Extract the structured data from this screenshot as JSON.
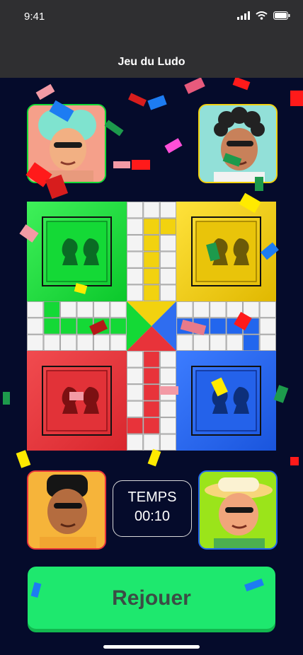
{
  "status_bar": {
    "time": "9:41"
  },
  "header": {
    "title": "Jeu du Ludo"
  },
  "board": {
    "colors": {
      "green": "#14d936",
      "yellow": "#f2d20f",
      "red": "#e8333a",
      "blue": "#2266ee"
    }
  },
  "players": [
    {
      "position": "top-left",
      "color": "#14d936",
      "avatar": "avatar-mint-hair"
    },
    {
      "position": "top-right",
      "color": "#f2d20f",
      "avatar": "avatar-braids"
    },
    {
      "position": "bottom-left",
      "color": "#e8333a",
      "avatar": "avatar-black-hair"
    },
    {
      "position": "bottom-right",
      "color": "#2266ee",
      "avatar": "avatar-straw-hat"
    }
  ],
  "timer": {
    "label": "TEMPS",
    "value": "00:10"
  },
  "actions": {
    "replay_label": "Rejouer"
  }
}
